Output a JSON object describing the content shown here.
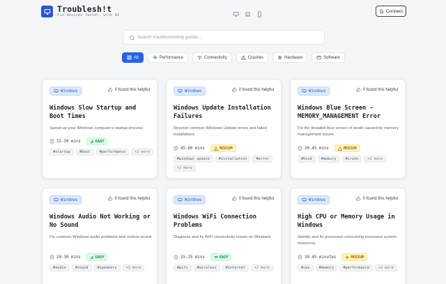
{
  "app": {
    "title": "Troublesh!t",
    "subtitle": "Fix devices faster, with AI",
    "connect_label": "Connect"
  },
  "device_icons": [
    "monitor-icon",
    "laptop-icon",
    "phone-icon"
  ],
  "search": {
    "placeholder": "Search troubleshooting guides...",
    "value": ""
  },
  "filters": [
    {
      "label": "All",
      "icon": "grid-icon",
      "active": true
    },
    {
      "label": "Performance",
      "icon": "sparkle-icon",
      "active": false
    },
    {
      "label": "Connectivity",
      "icon": "wifi-icon",
      "active": false
    },
    {
      "label": "Crashes",
      "icon": "warning-icon",
      "active": false
    },
    {
      "label": "Hardware",
      "icon": "chip-icon",
      "active": false
    },
    {
      "label": "Software",
      "icon": "window-icon",
      "active": false
    }
  ],
  "colors": {
    "accent": "#2563eb",
    "easy": "#15803d",
    "medium": "#a16207"
  },
  "cards": [
    {
      "platform": "Windows",
      "helpful": "0 found this helpful",
      "title": "Windows Slow Startup and Boot Times",
      "desc": "Speed up your Windows computer's startup process",
      "duration": "15-30 mins",
      "difficulty": "EASY",
      "tags": [
        "#startup",
        "#boot",
        "#performance"
      ],
      "more": "+2 more"
    },
    {
      "platform": "Windows",
      "helpful": "0 found this helpful",
      "title": "Windows Update Installation Failures",
      "desc": "Resolve common Windows Update errors and failed installations",
      "duration": "45-60 mins",
      "difficulty": "MEDIUM",
      "tags": [
        "#windows update",
        "#installation",
        "#error"
      ],
      "more": "+2 more"
    },
    {
      "platform": "Windows",
      "helpful": "0 found this helpful",
      "title": "Windows Blue Screen - MEMORY_MANAGEMENT Error",
      "desc": "Fix the dreaded blue screen of death caused by memory management issues",
      "duration": "30-45 mins",
      "difficulty": "MEDIUM",
      "tags": [
        "#bsod",
        "#memory",
        "#crash"
      ],
      "more": "+2 more"
    },
    {
      "platform": "Windows",
      "helpful": "0 found this helpful",
      "title": "Windows Audio Not Working or No Sound",
      "desc": "Fix common Windows audio problems and restore sound",
      "duration": "20-30 mins",
      "difficulty": "EASY",
      "tags": [
        "#audio",
        "#sound",
        "#speakers"
      ],
      "more": "+2 more"
    },
    {
      "platform": "Windows",
      "helpful": "0 found this helpful",
      "title": "Windows WiFi Connection Problems",
      "desc": "Diagnose and fix WiFi connectivity issues on Windows",
      "duration": "15-25 mins",
      "difficulty": "EASY",
      "tags": [
        "#wifi",
        "#wireless",
        "#internet"
      ],
      "more": "+2 more"
    },
    {
      "platform": "Windows",
      "helpful": "0 found this helpful",
      "title": "High CPU or Memory Usage in Windows",
      "desc": "Identify and fix processes consuming excessive system resources",
      "duration": "30-45 minutes",
      "difficulty": "MEDIUM",
      "tags": [
        "#cpu",
        "#memory",
        "#performance"
      ],
      "more": "+2 more"
    }
  ]
}
